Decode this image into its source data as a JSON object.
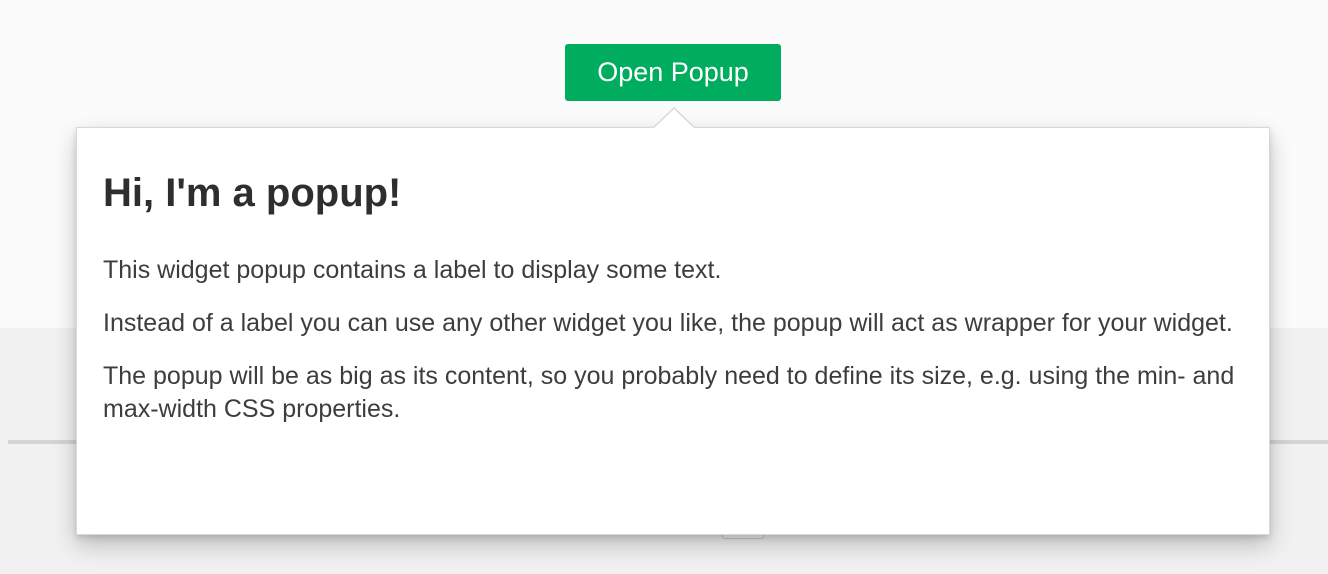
{
  "button": {
    "label": "Open Popup",
    "color": "#00ad5f"
  },
  "popup": {
    "title": "Hi, I'm a popup!",
    "paragraphs": [
      "This widget popup contains a label to display some text.",
      "Instead of a label you can use any other widget you like, the popup will act as wrapper for your widget.",
      "The popup will be as big as its content, so you probably need to define its size, e.g. using the min- and max-width CSS properties."
    ]
  }
}
